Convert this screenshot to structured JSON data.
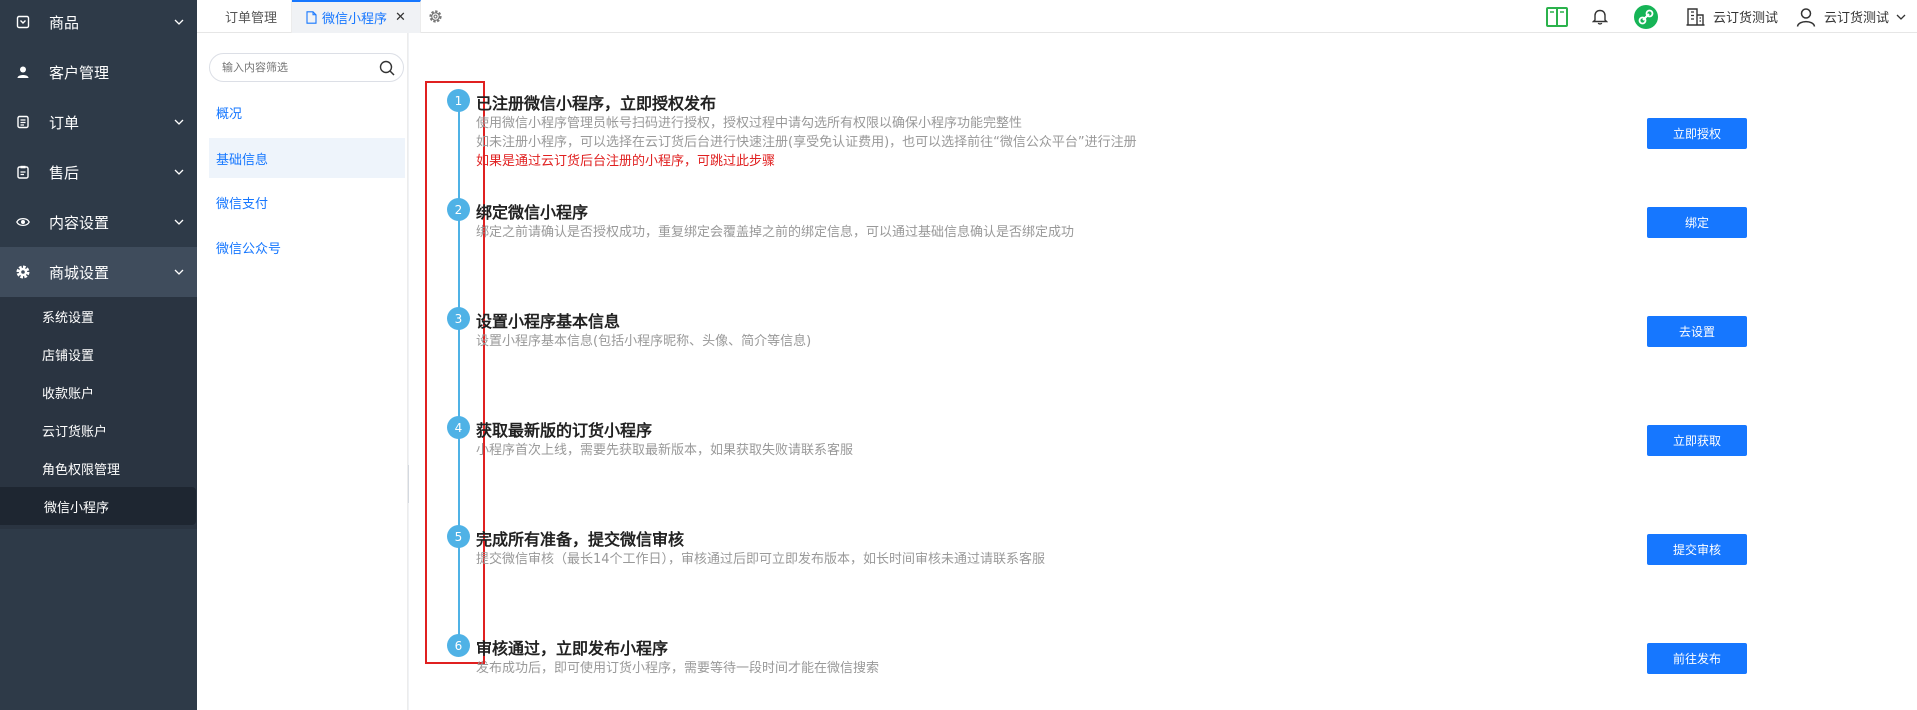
{
  "sidebar": {
    "items": [
      {
        "label": "商品",
        "icon": "box-icon"
      },
      {
        "label": "客户管理",
        "icon": "user-icon"
      },
      {
        "label": "订单",
        "icon": "list-icon"
      },
      {
        "label": "售后",
        "icon": "clipboard-icon"
      },
      {
        "label": "内容设置",
        "icon": "eye-icon"
      },
      {
        "label": "商城设置",
        "icon": "gear-icon"
      }
    ],
    "subitems": [
      "系统设置",
      "店铺设置",
      "收款账户",
      "云订货账户",
      "角色权限管理",
      "微信小程序"
    ]
  },
  "tabs": {
    "order": "订单管理",
    "wechat": "微信小程序",
    "close": "✕"
  },
  "header": {
    "store": "云订货测试",
    "user": "云订货测试"
  },
  "subnav": {
    "search_placeholder": "输入内容筛选",
    "items": [
      "概况",
      "基础信息",
      "微信支付",
      "微信公众号"
    ]
  },
  "steps": [
    {
      "num": "1",
      "title": "已注册微信小程序，立即授权发布",
      "desc1": "使用微信小程序管理员帐号扫码进行授权，授权过程中请勾选所有权限以确保小程序功能完整性",
      "desc2": "如未注册小程序，可以选择在云订货后台进行快速注册(享受免认证费用)，也可以选择前往“微信公众平台”进行注册",
      "desc3": "如果是通过云订货后台注册的小程序，可跳过此步骤",
      "button": "立即授权"
    },
    {
      "num": "2",
      "title": "绑定微信小程序",
      "desc1": "绑定之前请确认是否授权成功，重复绑定会覆盖掉之前的绑定信息，可以通过基础信息确认是否绑定成功",
      "button": "绑定"
    },
    {
      "num": "3",
      "title": "设置小程序基本信息",
      "desc1": "设置小程序基本信息(包括小程序昵称、头像、简介等信息)",
      "button": "去设置"
    },
    {
      "num": "4",
      "title": "获取最新版的订货小程序",
      "desc1": "小程序首次上线，需要先获取最新版本，如果获取失败请联系客服",
      "button": "立即获取"
    },
    {
      "num": "5",
      "title": "完成所有准备，提交微信审核",
      "desc1": "提交微信审核（最长14个工作日），审核通过后即可立即发布版本，如长时间审核未通过请联系客服",
      "button": "提交审核"
    },
    {
      "num": "6",
      "title": "审核通过，立即发布小程序",
      "desc1": "发布成功后，即可使用订货小程序，需要等待一段时间才能在微信搜索",
      "button": "前往发布"
    }
  ]
}
